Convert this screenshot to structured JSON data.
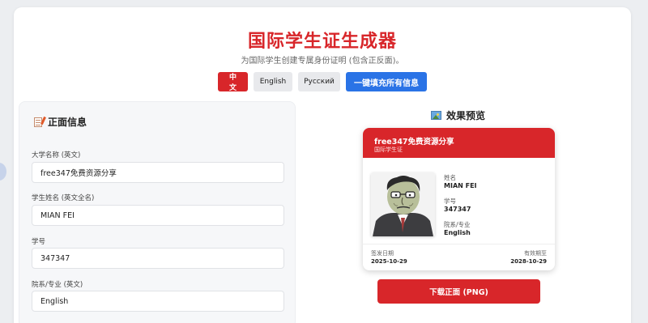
{
  "header": {
    "title": "国际学生证生成器",
    "subtitle": "为国际学生创建专属身份证明 (包含正反面)。"
  },
  "language_buttons": [
    {
      "label": "中文",
      "active": true
    },
    {
      "label": "English",
      "active": false
    },
    {
      "label": "Русский",
      "active": false
    }
  ],
  "fill_all_button": "一键填充所有信息",
  "form": {
    "heading": "正面信息",
    "heading_icon": "memo-icon",
    "fields": [
      {
        "label": "大学名称 (英文)",
        "value": "free347免费资源分享"
      },
      {
        "label": "学生姓名 (英文全名)",
        "value": "MIAN FEI"
      },
      {
        "label": "学号",
        "value": "347347"
      },
      {
        "label": "院系/专业 (英文)",
        "value": "English"
      }
    ]
  },
  "preview": {
    "heading": "效果预览",
    "heading_icon": "picture-icon"
  },
  "card": {
    "school": "free347免费资源分享",
    "card_type": "国际学生证",
    "name_label": "姓名",
    "name_value": "MIAN FEI",
    "id_label": "学号",
    "id_value": "347347",
    "major_label": "院系/专业",
    "major_value": "English",
    "issue_label": "签发日期",
    "issue_value": "2025-10-29",
    "expiry_label": "有效期至",
    "expiry_value": "2028-10-29"
  },
  "download_button": "下载正面 (PNG)",
  "colors": {
    "accent_red": "#d8262a",
    "accent_blue": "#2a73e6",
    "background": "#eceef1"
  }
}
